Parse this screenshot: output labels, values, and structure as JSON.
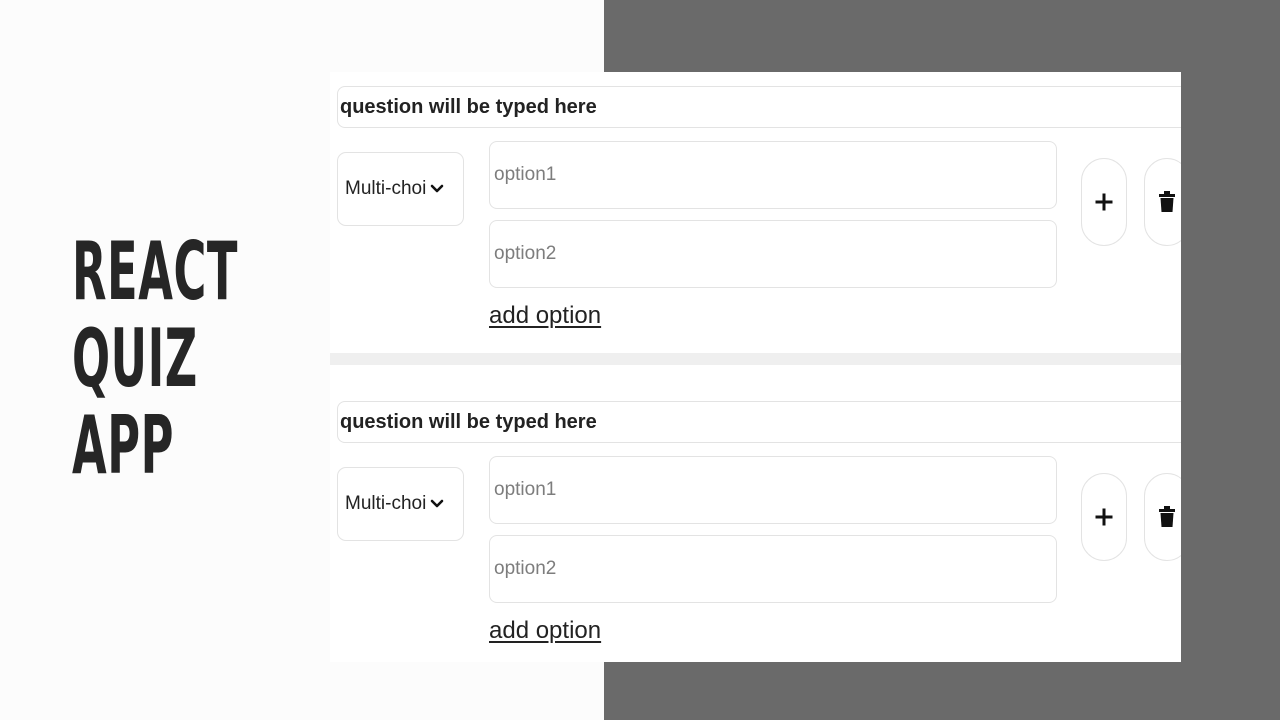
{
  "hero": {
    "lines": [
      "REACT",
      "QUIZ",
      "APP"
    ]
  },
  "questions": [
    {
      "question_text": "question will be typed here",
      "type_value": "Multi-choi",
      "options": [
        "option1",
        "option2"
      ],
      "add_option_label": "add option"
    },
    {
      "question_text": "question will be typed here",
      "type_value": "Multi-choi",
      "options": [
        "option1",
        "option2"
      ],
      "add_option_label": "add option"
    }
  ],
  "icons": {
    "add": "plus-icon",
    "delete": "trash-icon",
    "select": "chevron-down-icon"
  },
  "colors": {
    "panel": "#6a6a6a",
    "title": "#262626",
    "divider": "#efefef"
  }
}
